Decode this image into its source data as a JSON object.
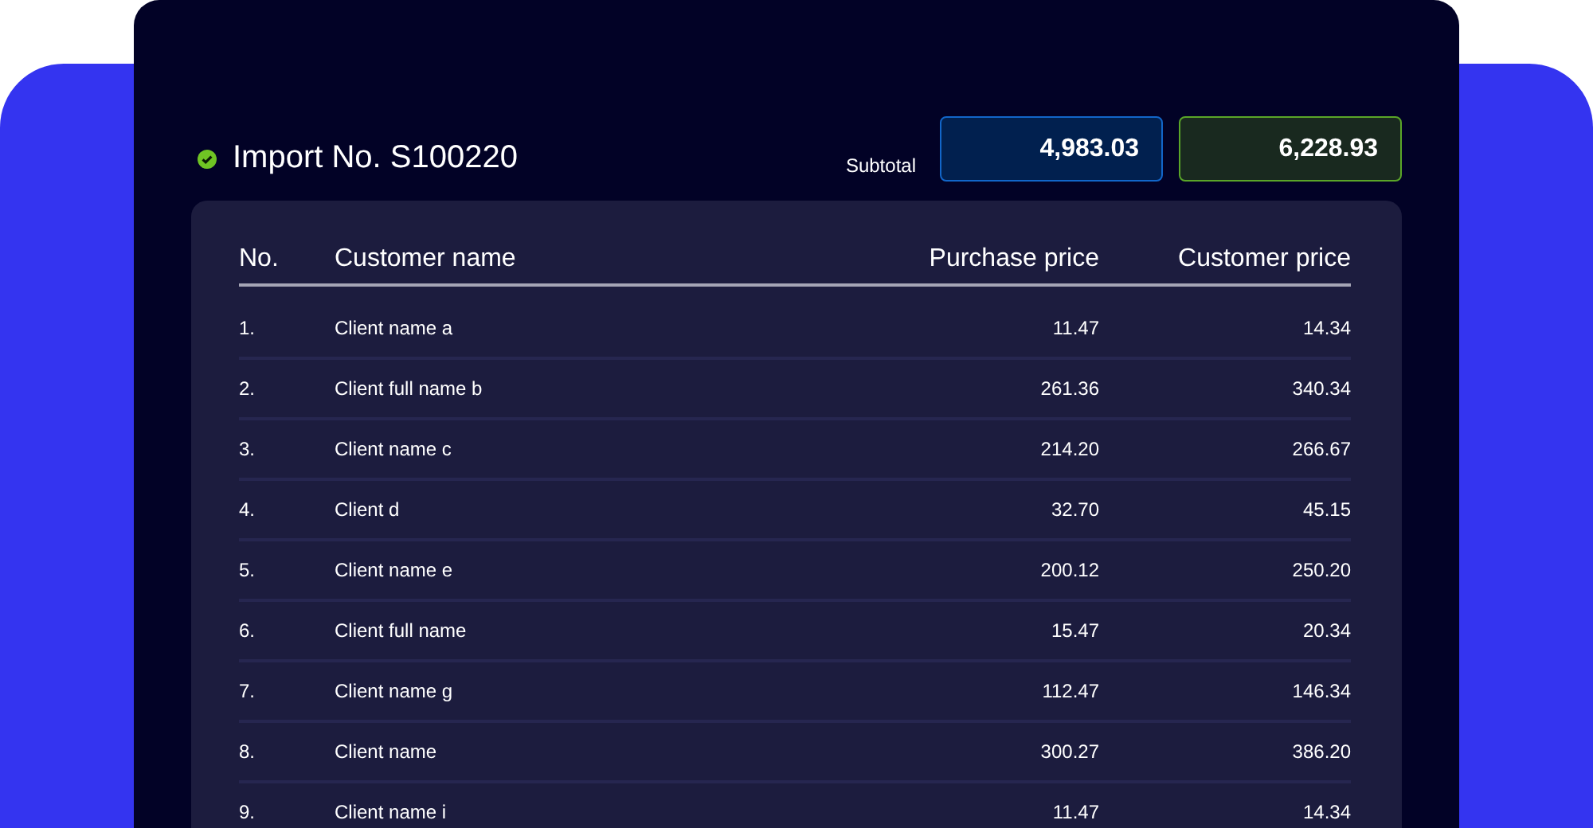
{
  "header": {
    "title": "Import No. S100220",
    "subtotal_label": "Subtotal",
    "totals": [
      {
        "kind": "purchase",
        "value": "4,983.03"
      },
      {
        "kind": "customer",
        "value": "6,228.93"
      }
    ]
  },
  "table": {
    "columns": [
      "No.",
      "Customer name",
      "Purchase price",
      "Customer price"
    ],
    "rows": [
      [
        "1.",
        "Client name a",
        "11.47",
        "14.34"
      ],
      [
        "2.",
        "Client full name b",
        "261.36",
        "340.34"
      ],
      [
        "3.",
        "Client name c",
        "214.20",
        "266.67"
      ],
      [
        "4.",
        "Client d",
        "32.70",
        "45.15"
      ],
      [
        "5.",
        "Client name e",
        "200.12",
        "250.20"
      ],
      [
        "6.",
        "Client full name",
        "15.47",
        "20.34"
      ],
      [
        "7.",
        "Client name g",
        "112.47",
        "146.34"
      ],
      [
        "8.",
        "Client name",
        "300.27",
        "386.20"
      ],
      [
        "9.",
        "Client name i",
        "11.47",
        "14.34"
      ]
    ]
  }
}
